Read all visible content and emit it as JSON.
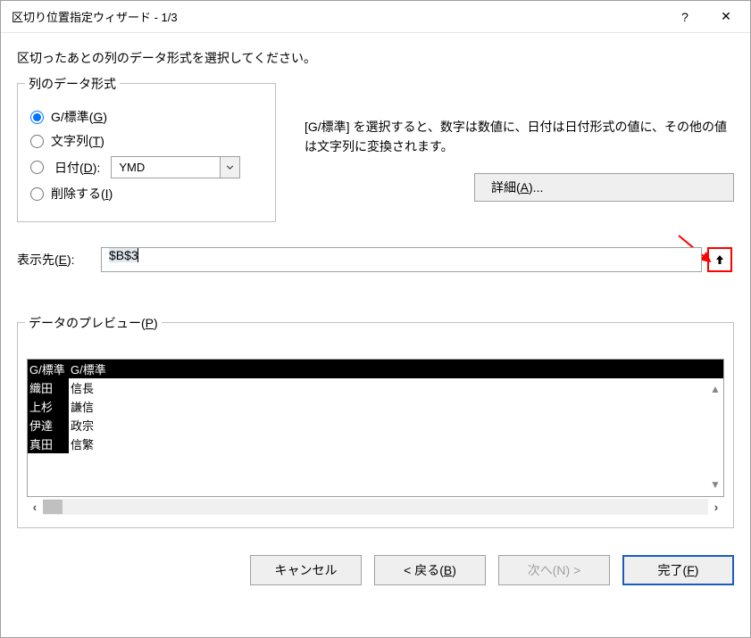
{
  "titlebar": {
    "title": "区切り位置指定ウィザード - 1/3",
    "help": "?",
    "close": "✕"
  },
  "instruction": "区切ったあとの列のデータ形式を選択してください。",
  "fieldset": {
    "legend": "列のデータ形式",
    "radio_general_prefix": "G/標準(",
    "radio_general_u": "G",
    "radio_general_suffix": ")",
    "radio_text_prefix": "文字列(",
    "radio_text_u": "T",
    "radio_text_suffix": ")",
    "radio_date_prefix": "日付(",
    "radio_date_u": "D",
    "radio_date_suffix": "):",
    "date_format": "YMD",
    "radio_skip_prefix": "削除する(",
    "radio_skip_u": "I",
    "radio_skip_suffix": ")"
  },
  "description": "[G/標準] を選択すると、数字は数値に、日付は日付形式の値に、その他の値は文字列に変換されます。",
  "detail_btn_prefix": "詳細(",
  "detail_btn_u": "A",
  "detail_btn_suffix": ")...",
  "destination": {
    "label_prefix": "表示先(",
    "label_u": "E",
    "label_suffix": "):",
    "value": "$B$3"
  },
  "preview": {
    "legend_prefix": "データのプレビュー(",
    "legend_u": "P",
    "legend_suffix": ")",
    "headers": [
      "G/標準",
      "G/標準"
    ],
    "col1": [
      "織田",
      "上杉",
      "伊達",
      "真田"
    ],
    "col2": [
      "信長",
      "謙信",
      "政宗",
      "信繁"
    ]
  },
  "buttons": {
    "cancel": "キャンセル",
    "back_prefix": "< 戻る(",
    "back_u": "B",
    "back_suffix": ")",
    "next": "次へ(N) >",
    "finish_prefix": "完了(",
    "finish_u": "F",
    "finish_suffix": ")"
  }
}
